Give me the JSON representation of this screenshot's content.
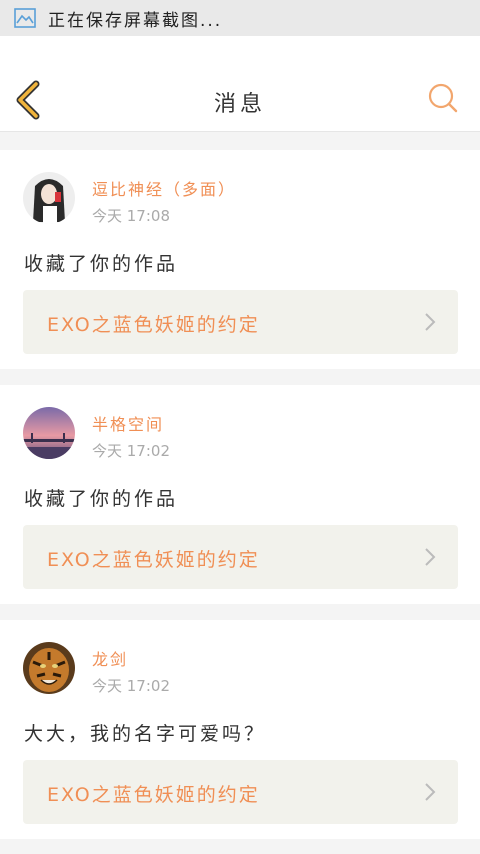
{
  "status_bar": {
    "icon": "image-icon",
    "text": "正在保存屏幕截图..."
  },
  "header": {
    "back_icon": "chevron-left-icon",
    "title": "消息",
    "search_icon": "search-icon",
    "accent_color": "#f0b43c"
  },
  "messages": [
    {
      "user": "逗比神经（多面）",
      "time": "今天 17:08",
      "text": "收藏了你的作品",
      "work": "EXO之蓝色妖姬的约定"
    },
    {
      "user": "半格空间",
      "time": "今天 17:02",
      "text": "收藏了你的作品",
      "work": "EXO之蓝色妖姬的约定"
    },
    {
      "user": "龙剑",
      "time": "今天 17:02",
      "text": "大大，我的名字可爱吗？",
      "work": "EXO之蓝色妖姬的约定"
    }
  ],
  "colors": {
    "name_color": "#f08f55",
    "time_color": "#aaaaaa",
    "work_bg": "#f2f2ec"
  }
}
